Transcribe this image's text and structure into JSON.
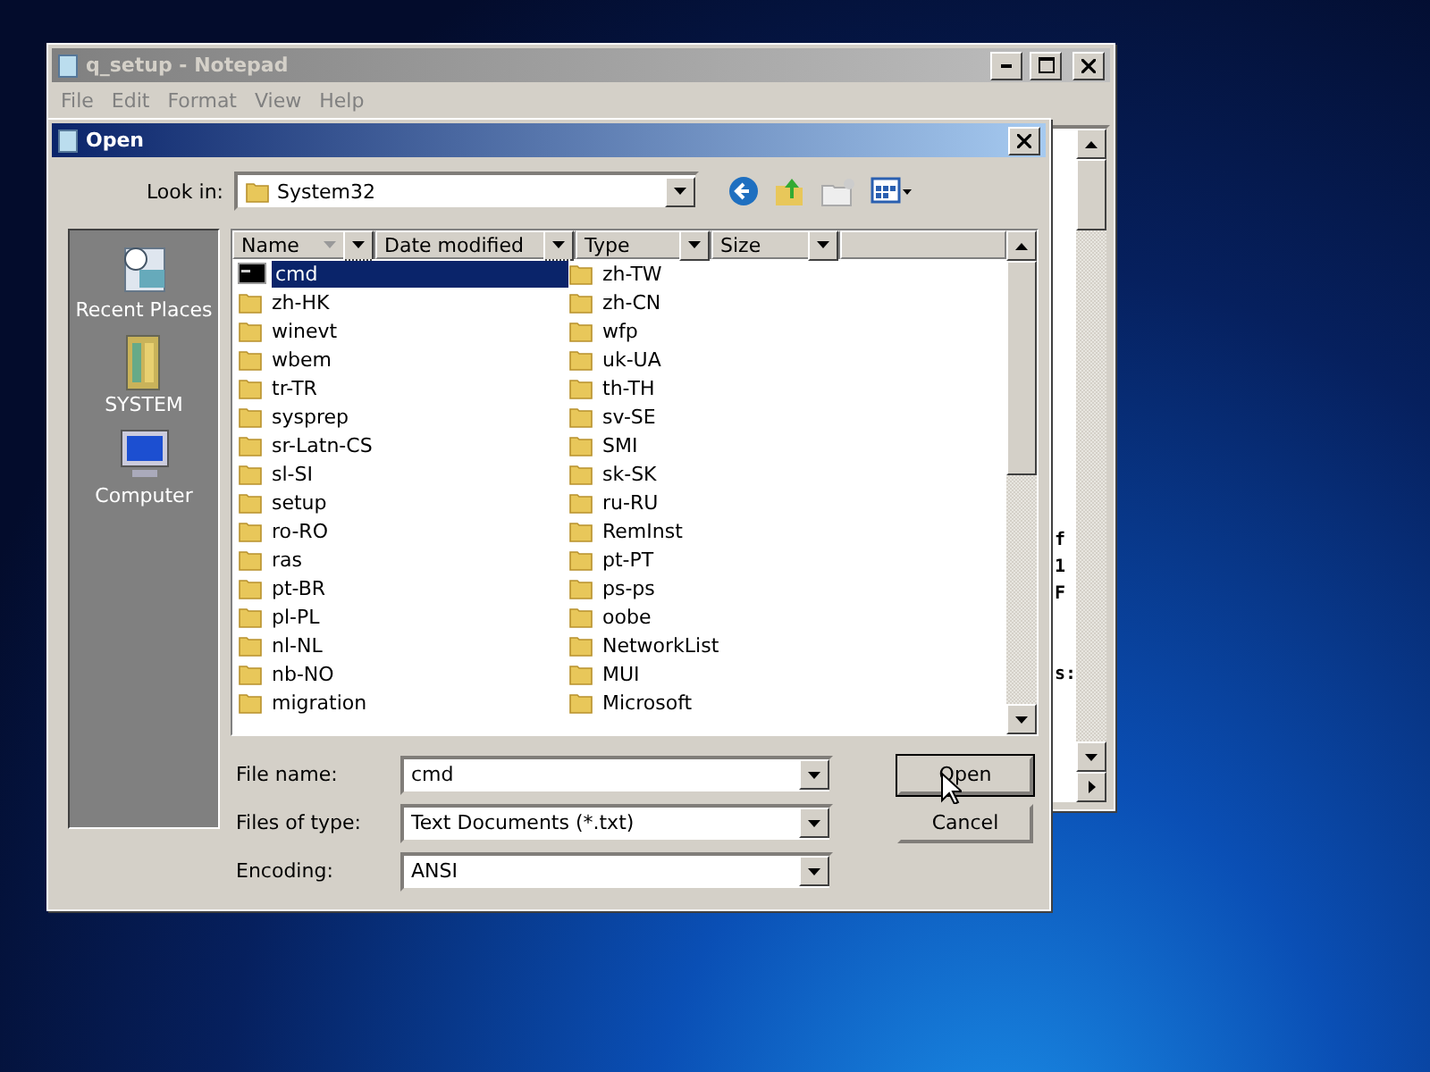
{
  "notepad": {
    "title": "q_setup - Notepad",
    "menu": [
      "File",
      "Edit",
      "Format",
      "View",
      "Help"
    ],
    "text_fragments": [
      "f",
      "1",
      "F",
      "s:"
    ]
  },
  "dialog": {
    "title": "Open",
    "look_in_label": "Look in:",
    "look_in": "System32",
    "places": [
      {
        "label": "Recent Places",
        "kind": "recent"
      },
      {
        "label": "SYSTEM",
        "kind": "user"
      },
      {
        "label": "Computer",
        "kind": "computer"
      }
    ],
    "columns": [
      "Name",
      "Date modified",
      "Type",
      "Size"
    ],
    "files": [
      {
        "name": "cmd",
        "kind": "program",
        "selected": true
      },
      {
        "name": "zh-HK",
        "kind": "folder",
        "selected": false
      },
      {
        "name": "winevt",
        "kind": "folder",
        "selected": false
      },
      {
        "name": "wbem",
        "kind": "folder",
        "selected": false
      },
      {
        "name": "tr-TR",
        "kind": "folder",
        "selected": false
      },
      {
        "name": "sysprep",
        "kind": "folder",
        "selected": false
      },
      {
        "name": "sr-Latn-CS",
        "kind": "folder",
        "selected": false
      },
      {
        "name": "sl-SI",
        "kind": "folder",
        "selected": false
      },
      {
        "name": "setup",
        "kind": "folder",
        "selected": false
      },
      {
        "name": "ro-RO",
        "kind": "folder",
        "selected": false
      },
      {
        "name": "ras",
        "kind": "folder",
        "selected": false
      },
      {
        "name": "pt-BR",
        "kind": "folder",
        "selected": false
      },
      {
        "name": "pl-PL",
        "kind": "folder",
        "selected": false
      },
      {
        "name": "nl-NL",
        "kind": "folder",
        "selected": false
      },
      {
        "name": "nb-NO",
        "kind": "folder",
        "selected": false
      },
      {
        "name": "migration",
        "kind": "folder",
        "selected": false
      },
      {
        "name": "zh-TW",
        "kind": "folder",
        "selected": false
      },
      {
        "name": "zh-CN",
        "kind": "folder",
        "selected": false
      },
      {
        "name": "wfp",
        "kind": "folder",
        "selected": false
      },
      {
        "name": "uk-UA",
        "kind": "folder",
        "selected": false
      },
      {
        "name": "th-TH",
        "kind": "folder",
        "selected": false
      },
      {
        "name": "sv-SE",
        "kind": "folder",
        "selected": false
      },
      {
        "name": "SMI",
        "kind": "folder",
        "selected": false
      },
      {
        "name": "sk-SK",
        "kind": "folder",
        "selected": false
      },
      {
        "name": "ru-RU",
        "kind": "folder",
        "selected": false
      },
      {
        "name": "RemInst",
        "kind": "folder",
        "selected": false
      },
      {
        "name": "pt-PT",
        "kind": "folder",
        "selected": false
      },
      {
        "name": "ps-ps",
        "kind": "folder",
        "selected": false
      },
      {
        "name": "oobe",
        "kind": "folder",
        "selected": false
      },
      {
        "name": "NetworkList",
        "kind": "folder",
        "selected": false
      },
      {
        "name": "MUI",
        "kind": "folder",
        "selected": false
      },
      {
        "name": "Microsoft",
        "kind": "folder",
        "selected": false
      }
    ],
    "fields": [
      {
        "label": "File name:",
        "value": "cmd"
      },
      {
        "label": "Files of type:",
        "value": "Text Documents (*.txt)"
      },
      {
        "label": "Encoding:",
        "value": "ANSI"
      }
    ],
    "buttons": [
      "Open",
      "Cancel"
    ]
  }
}
